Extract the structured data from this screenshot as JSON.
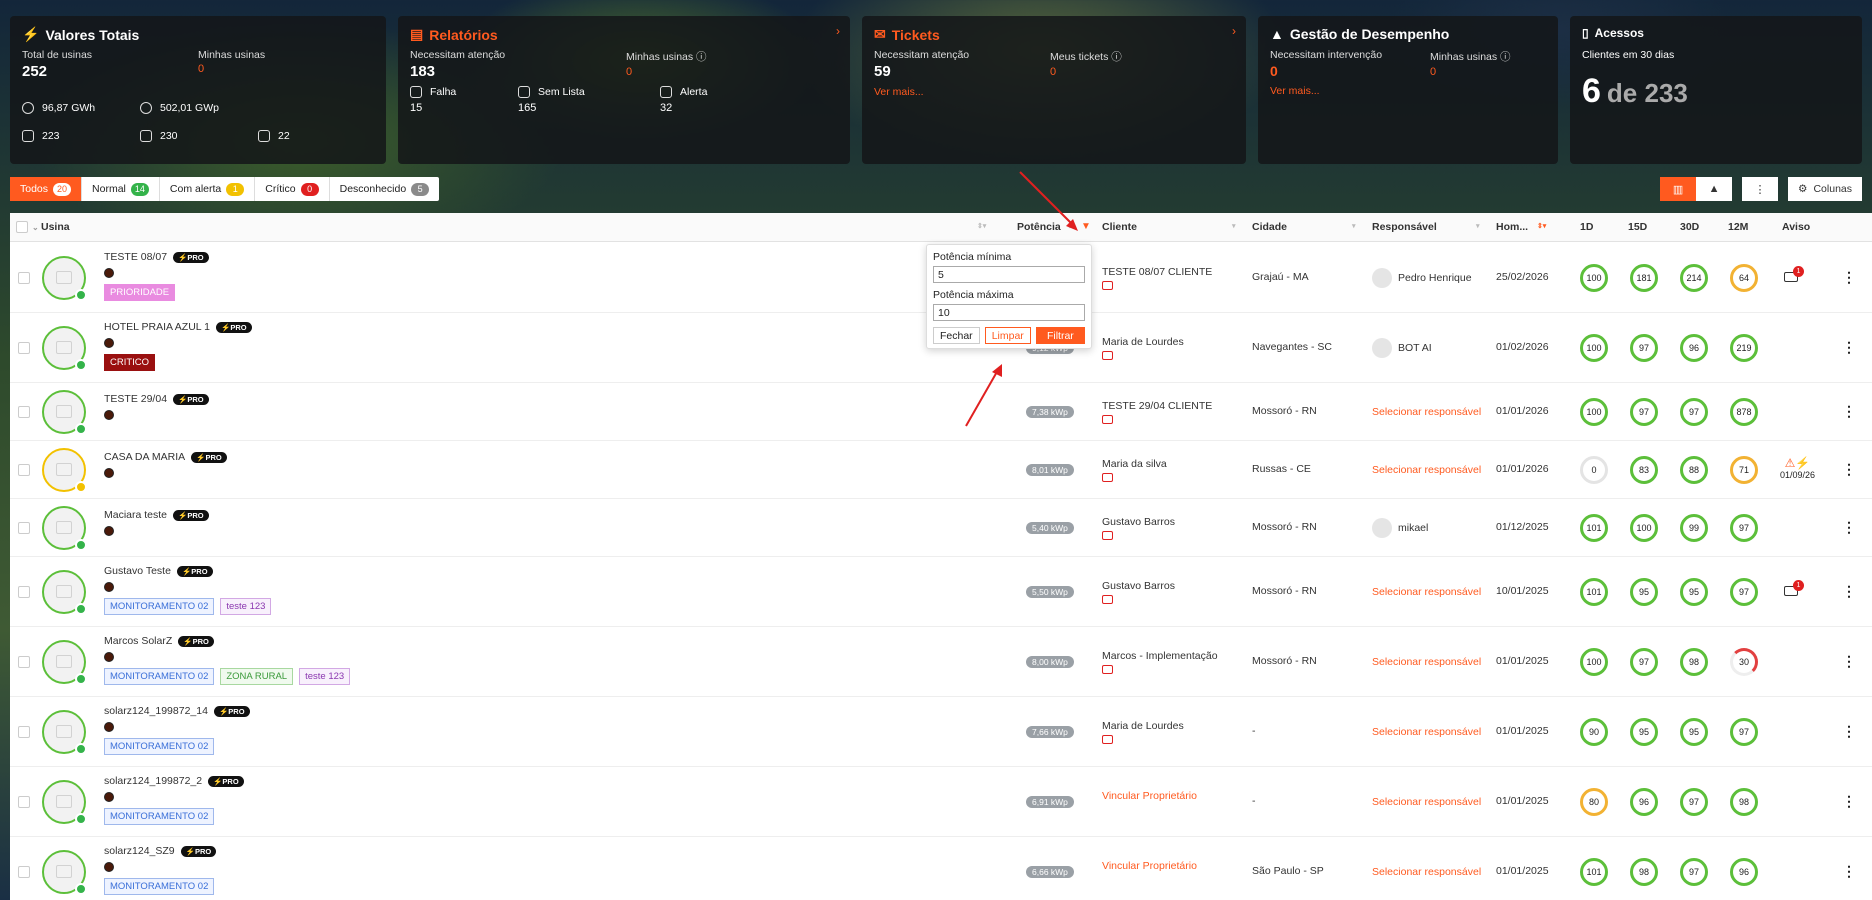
{
  "cards": {
    "totais": {
      "title": "Valores Totais",
      "total_label": "Total de usinas",
      "total": "252",
      "mine_label": "Minhas usinas",
      "mine": "0",
      "energy": "96,87 GWh",
      "power": "502,01 GWp",
      "s1": "223",
      "s2": "230",
      "s3": "22"
    },
    "relatorios": {
      "title": "Relatórios",
      "need_label": "Necessitam atenção",
      "need": "183",
      "mine_label": "Minhas usinas",
      "mine": "0",
      "falha_label": "Falha",
      "falha": "15",
      "semlista_label": "Sem Lista",
      "semlista": "165",
      "alerta_label": "Alerta",
      "alerta": "32"
    },
    "tickets": {
      "title": "Tickets",
      "need_label": "Necessitam atenção",
      "need": "59",
      "mine_label": "Meus tickets",
      "mine": "0",
      "more": "Ver mais..."
    },
    "gestao": {
      "title": "Gestão de Desempenho",
      "need_label": "Necessitam intervenção",
      "need": "0",
      "mine_label": "Minhas usinas",
      "mine": "0",
      "more": "Ver mais..."
    },
    "acessos": {
      "title": "Acessos",
      "sub": "Clientes em 30 dias",
      "big": "6",
      "of": "de 233"
    }
  },
  "filters": [
    {
      "label": "Todos",
      "count": "20",
      "color": "#ffffff"
    },
    {
      "label": "Normal",
      "count": "14",
      "color": "#34b34a"
    },
    {
      "label": "Com alerta",
      "count": "1",
      "color": "#f2c100"
    },
    {
      "label": "Crítico",
      "count": "0",
      "color": "#e02020"
    },
    {
      "label": "Desconhecido",
      "count": "5",
      "color": "#8a8a8a"
    }
  ],
  "toolbar": {
    "columns_label": "Colunas"
  },
  "headers": {
    "usina": "Usina",
    "potencia": "Potência",
    "cliente": "Cliente",
    "cidade": "Cidade",
    "responsavel": "Responsável",
    "hom": "Hom...",
    "d1": "1D",
    "d15": "15D",
    "d30": "30D",
    "m12": "12M",
    "aviso": "Aviso"
  },
  "popup": {
    "min_label": "Potência mínima",
    "min_value": "5",
    "max_label": "Potência máxima",
    "max_value": "10",
    "close": "Fechar",
    "clear": "Limpar",
    "filter": "Filtrar"
  },
  "rows": [
    {
      "name": "TESTE 08/07",
      "tag1": "PRIORIDADE",
      "kwp": "",
      "cliente": "TESTE 08/07 CLIENTE",
      "cidade": "Grajaú - MA",
      "resp": "Pedro Henrique",
      "hom": "25/02/2026",
      "d1": "100",
      "d15": "181",
      "d30": "214",
      "m12": "64",
      "aviso_count": "1"
    },
    {
      "name": "HOTEL PRAIA AZUL 1",
      "tag1": "CRITICO",
      "kwp": "9,12 kWp",
      "cliente": "Maria de Lourdes",
      "cidade": "Navegantes - SC",
      "resp": "BOT AI",
      "hom": "01/02/2026",
      "d1": "100",
      "d15": "97",
      "d30": "96",
      "m12": "219"
    },
    {
      "name": "TESTE 29/04",
      "kwp": "7,38 kWp",
      "cliente": "TESTE 29/04 CLIENTE",
      "cidade": "Mossoró - RN",
      "resp": "Selecionar responsável",
      "hom": "01/01/2026",
      "d1": "100",
      "d15": "97",
      "d30": "97",
      "m12": "878"
    },
    {
      "name": "CASA DA MARIA",
      "kwp": "8,01 kWp",
      "cliente": "Maria da silva",
      "cidade": "Russas - CE",
      "resp": "Selecionar responsável",
      "hom": "01/01/2026",
      "d1": "0",
      "d15": "83",
      "d30": "88",
      "m12": "71",
      "aviso_date": "01/09/26"
    },
    {
      "name": "Maciara teste",
      "kwp": "5,40 kWp",
      "cliente": "Gustavo Barros",
      "cidade": "Mossoró - RN",
      "resp": "mikael",
      "hom": "01/12/2025",
      "d1": "101",
      "d15": "100",
      "d30": "99",
      "m12": "97"
    },
    {
      "name": "Gustavo Teste",
      "tag1": "MONITORAMENTO 02",
      "tag2": "teste 123",
      "kwp": "5,50 kWp",
      "cliente": "Gustavo Barros",
      "cidade": "Mossoró - RN",
      "resp": "Selecionar responsável",
      "hom": "10/01/2025",
      "d1": "101",
      "d15": "95",
      "d30": "95",
      "m12": "97",
      "aviso_count": "1"
    },
    {
      "name": "Marcos SolarZ",
      "tag1": "MONITORAMENTO 02",
      "tag2": "ZONA RURAL",
      "tag3": "teste 123",
      "kwp": "8,00 kWp",
      "cliente": "Marcos - Implementação",
      "cidade": "Mossoró - RN",
      "resp": "Selecionar responsável",
      "hom": "01/01/2025",
      "d1": "100",
      "d15": "97",
      "d30": "98",
      "m12": "30"
    },
    {
      "name": "solarz124_199872_14",
      "tag1": "MONITORAMENTO 02",
      "kwp": "7,66 kWp",
      "cliente": "Maria de Lourdes",
      "cidade": "-",
      "resp": "Selecionar responsável",
      "hom": "01/01/2025",
      "d1": "90",
      "d15": "95",
      "d30": "95",
      "m12": "97"
    },
    {
      "name": "solarz124_199872_2",
      "tag1": "MONITORAMENTO 02",
      "kwp": "6,91 kWp",
      "cliente": "Vincular Proprietário",
      "cidade": "-",
      "resp": "Selecionar responsável",
      "hom": "01/01/2025",
      "d1": "80",
      "d15": "96",
      "d30": "97",
      "m12": "98"
    },
    {
      "name": "solarz124_SZ9",
      "tag1": "MONITORAMENTO 02",
      "kwp": "6,66 kWp",
      "cliente": "Vincular Proprietário",
      "cidade": "São Paulo - SP",
      "resp": "Selecionar responsável",
      "hom": "01/01/2025",
      "d1": "101",
      "d15": "98",
      "d30": "97",
      "m12": "96"
    }
  ]
}
